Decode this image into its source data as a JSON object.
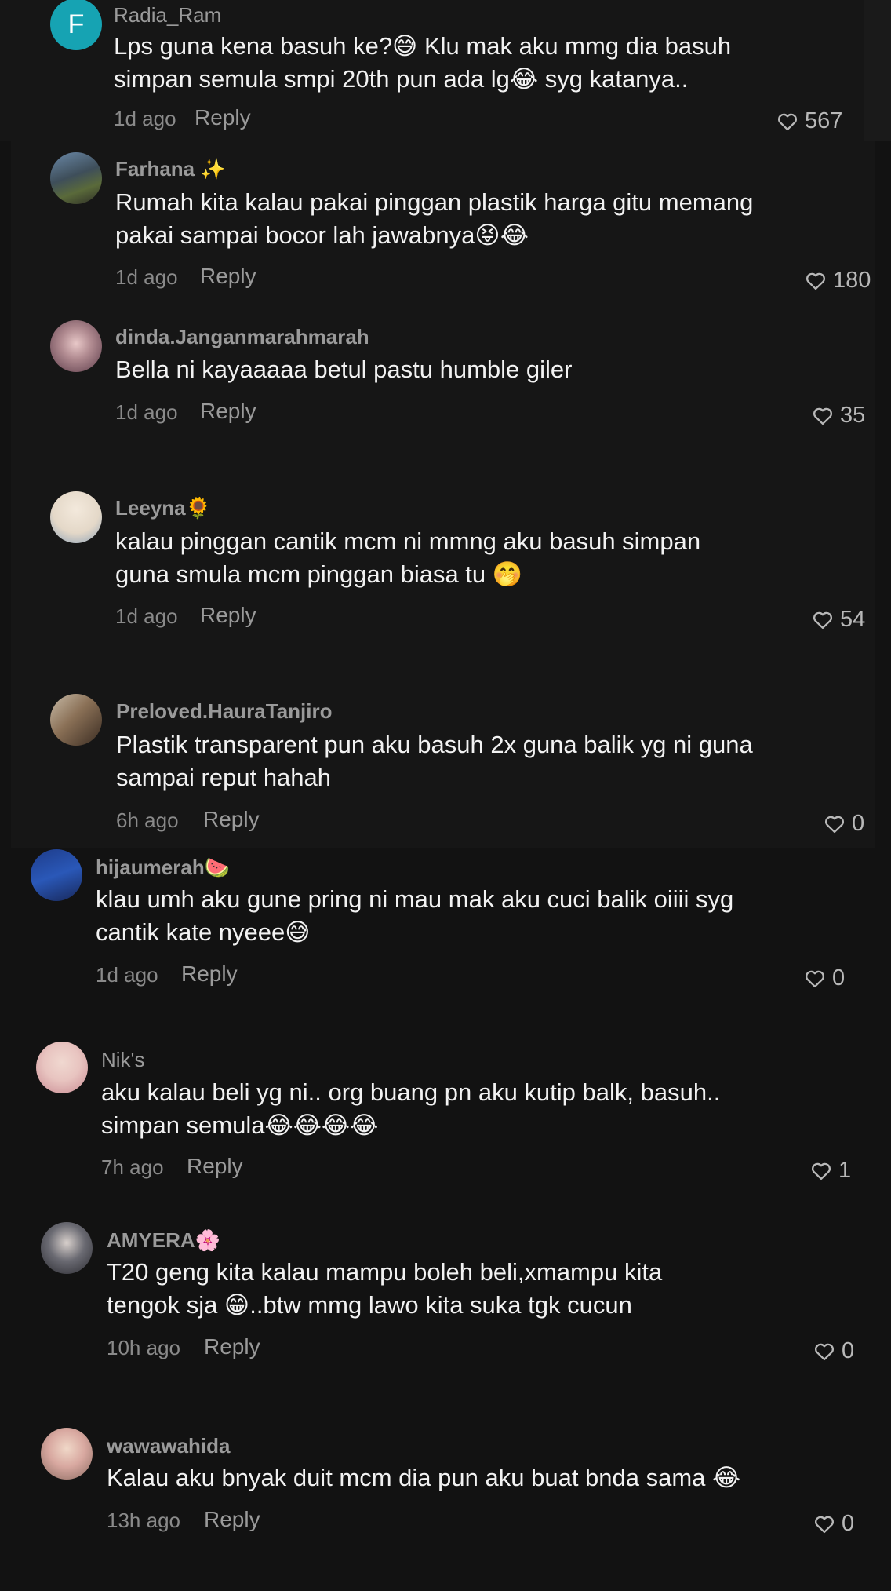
{
  "comments": [
    {
      "user": "Radia_Ram",
      "avatar_letter": "F",
      "lines": [
        "Lps guna kena basuh ke?😅 Klu mak aku mmg dia basuh",
        "simpan semula smpi 20th pun ada lg😂 syg katanya.."
      ],
      "time": "1d ago",
      "reply": "Reply",
      "likes": "567"
    },
    {
      "user": "Farhana ✨",
      "lines": [
        "Rumah kita kalau pakai pinggan plastik harga gitu memang",
        "pakai sampai bocor lah jawabnya😝😂"
      ],
      "time": "1d ago",
      "reply": "Reply",
      "likes": "180"
    },
    {
      "user": "dinda.Janganmarahmarah",
      "lines": [
        "Bella ni kayaaaaa betul pastu humble giler"
      ],
      "time": "1d ago",
      "reply": "Reply",
      "likes": "35"
    },
    {
      "user": "Leeyna🌻",
      "lines": [
        "kalau pinggan cantik mcm ni mmng aku basuh simpan",
        "guna smula mcm pinggan biasa tu 🤭"
      ],
      "time": "1d ago",
      "reply": "Reply",
      "likes": "54"
    },
    {
      "user": "Preloved.HauraTanjiro",
      "lines": [
        "Plastik transparent pun aku basuh 2x guna balik yg ni guna",
        "sampai reput hahah"
      ],
      "time": "6h ago",
      "reply": "Reply",
      "likes": "0"
    },
    {
      "user": "hijaumerah🍉",
      "lines": [
        "klau umh aku gune pring ni mau mak aku cuci balik oiiii syg",
        "cantik kate nyeee😅"
      ],
      "time": "1d ago",
      "reply": "Reply",
      "likes": "0"
    },
    {
      "user": "Nik's",
      "lines": [
        "aku kalau beli yg ni.. org buang pn aku kutip balk, basuh..",
        "simpan semula😂😂😂😂"
      ],
      "time": "7h ago",
      "reply": "Reply",
      "likes": "1"
    },
    {
      "user": "AMYERA🌸",
      "lines": [
        "T20 geng kita kalau mampu boleh beli,xmampu kita",
        "tengok sja 😁..btw mmg lawo kita suka tgk cucun"
      ],
      "time": "10h ago",
      "reply": "Reply",
      "likes": "0"
    },
    {
      "user": "wawawahida",
      "lines": [
        "Kalau aku bnyak duit mcm dia pun aku buat bnda sama 😂"
      ],
      "time": "13h ago",
      "reply": "Reply",
      "likes": "0"
    }
  ],
  "colors": {
    "background": "#121212",
    "text": "#f2f2f2",
    "muted": "#8a8a8a",
    "avatar_accent": "#16a3b3"
  }
}
